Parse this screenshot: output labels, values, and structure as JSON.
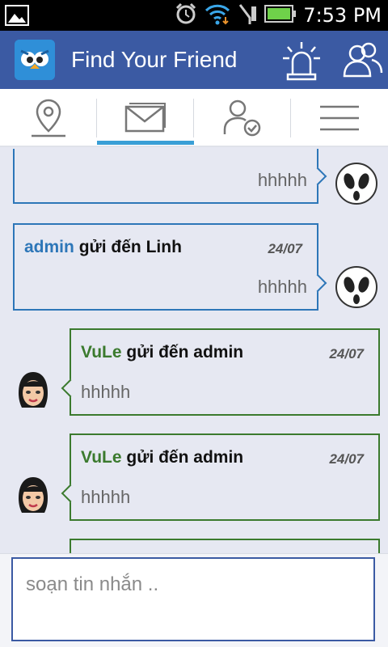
{
  "status": {
    "time": "7:53 PM"
  },
  "app": {
    "title": "Find Your Friend"
  },
  "tabs": [
    {
      "name": "map",
      "icon": "location-pin-icon"
    },
    {
      "name": "messages",
      "icon": "envelope-icon",
      "active": true
    },
    {
      "name": "friends",
      "icon": "user-check-icon"
    },
    {
      "name": "menu",
      "icon": "hamburger-menu-icon"
    }
  ],
  "messages": [
    {
      "direction": "out",
      "sender": "",
      "verb": "",
      "recipient": "",
      "date": "",
      "body": "hhhhh"
    },
    {
      "direction": "out",
      "sender": "admin",
      "verb": "gửi đến",
      "recipient": " Linh",
      "date": "24/07",
      "body": "hhhhh"
    },
    {
      "direction": "in",
      "sender": "VuLe",
      "verb": "gửi đến",
      "recipient": "admin",
      "date": "24/07",
      "body": "hhhhh"
    },
    {
      "direction": "in",
      "sender": "VuLe",
      "verb": "gửi đến",
      "recipient": "admin",
      "date": "24/07",
      "body": "hhhhh"
    }
  ],
  "composer": {
    "placeholder": "soạn tin nhắn .."
  },
  "colors": {
    "actionbar": "#3b5aa3",
    "accent": "#3a9fd6",
    "outgoing": "#2d76b8",
    "incoming": "#3b7a2e"
  }
}
